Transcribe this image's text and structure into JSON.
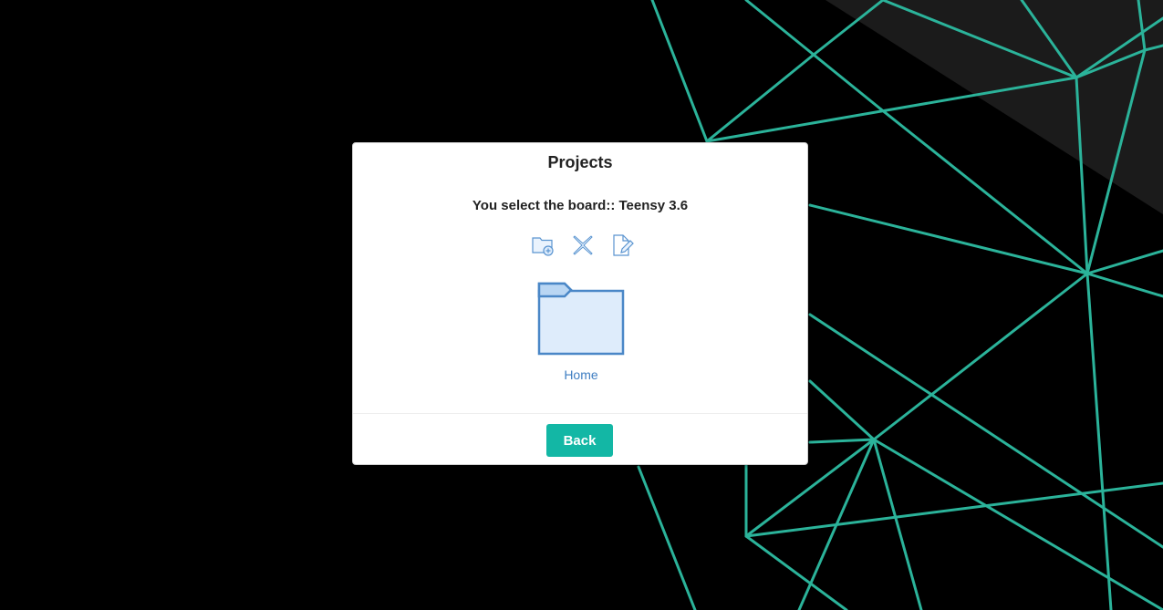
{
  "dialog": {
    "title": "Projects",
    "subtitle": "You select the board:: Teensy 3.6",
    "toolbar": {
      "icons": [
        "new-folder-icon",
        "delete-icon",
        "rename-icon"
      ]
    },
    "folders": [
      {
        "label": "Home",
        "icon": "folder-icon"
      }
    ],
    "back_label": "Back"
  },
  "colors": {
    "accent": "#13b7a5",
    "background_lines": "#2bb39a",
    "background": "#000000",
    "folder_stroke": "#4a87c7",
    "folder_fill": "#deecfb",
    "link": "#3f7ec2"
  }
}
